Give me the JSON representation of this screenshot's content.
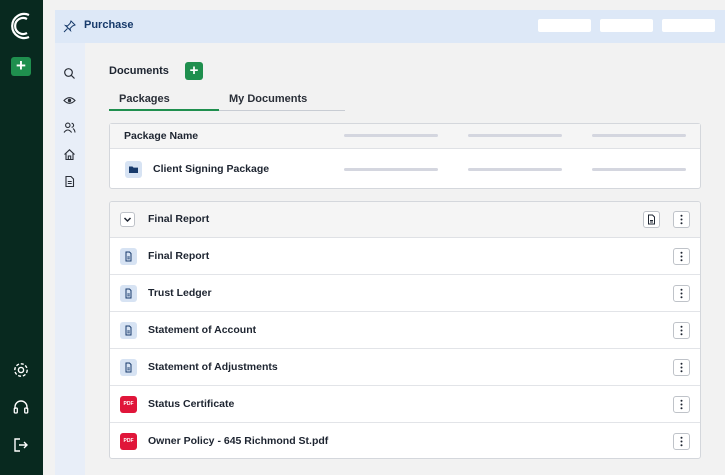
{
  "header": {
    "title": "Purchase"
  },
  "content": {
    "documents_label": "Documents",
    "tabs": [
      {
        "label": "Packages",
        "active": true
      },
      {
        "label": "My Documents",
        "active": false
      }
    ],
    "packages_table": {
      "column_header": "Package Name",
      "rows": [
        {
          "name": "Client Signing Package",
          "icon": "folder-icon"
        }
      ]
    },
    "document_group": {
      "title": "Final Report",
      "items": [
        {
          "name": "Final Report",
          "type": "doc"
        },
        {
          "name": "Trust Ledger",
          "type": "doc"
        },
        {
          "name": "Statement of Account",
          "type": "doc"
        },
        {
          "name": "Statement of Adjustments",
          "type": "doc"
        },
        {
          "name": "Status Certificate",
          "type": "pdf",
          "badge": "PDF"
        },
        {
          "name": "Owner Policy - 645 Richmond St.pdf",
          "type": "pdf",
          "badge": "PDF"
        }
      ]
    }
  },
  "colors": {
    "accent_green": "#1f8f4e",
    "rail_dark": "#08291f",
    "pdf_red": "#e0163a",
    "header_blue": "#dde8f7",
    "title_blue": "#173a6b"
  },
  "icons": {
    "rail_top": [
      "app-logo",
      "add-icon"
    ],
    "rail_bottom": [
      "settings-icon",
      "headset-icon",
      "logout-icon"
    ],
    "sidebar": [
      "search-icon",
      "eye-icon",
      "users-icon",
      "home-icon",
      "document-icon"
    ]
  }
}
